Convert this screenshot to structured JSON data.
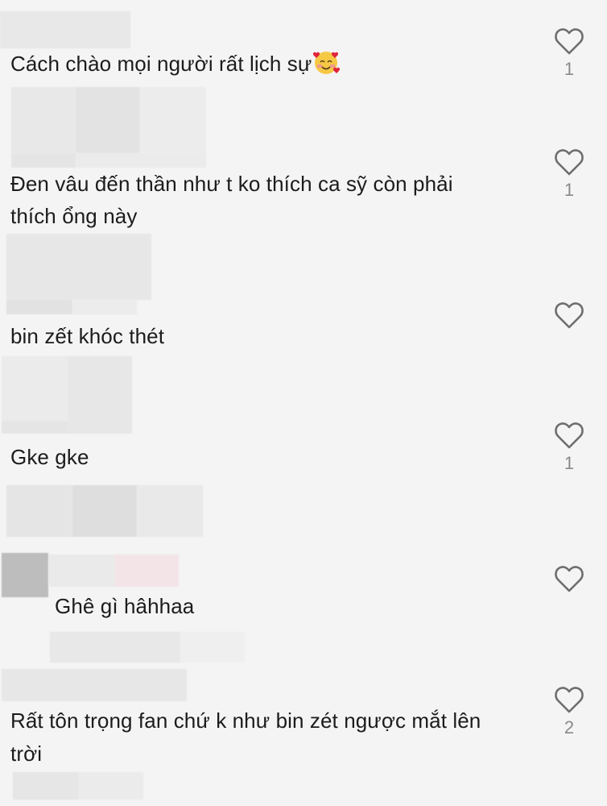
{
  "comments": [
    {
      "text": "Cách chào mọi người rất lịch sự",
      "likes": "1"
    },
    {
      "line1": "Đen vâu đến thần như t ko thích ca sỹ còn phải",
      "line2": "thích ổng này",
      "likes": "1"
    },
    {
      "text": "bin zết khóc thét",
      "likes": ""
    },
    {
      "text": "Gke gke",
      "likes": "1"
    },
    {
      "text": "Ghê gì hâhhaa",
      "likes": ""
    },
    {
      "line1": "Rất tôn trọng fan chứ k như bin zét ngược mắt lên",
      "line2": "trời",
      "likes": "2"
    }
  ],
  "icons": {
    "like": "heart-outline-icon",
    "emoji": "smiling-face-with-hearts-icon"
  },
  "colors": {
    "background": "#f4f4f4",
    "text": "#1c1c1c",
    "count": "#8a8a8a",
    "heart": "#6e6e6e"
  }
}
